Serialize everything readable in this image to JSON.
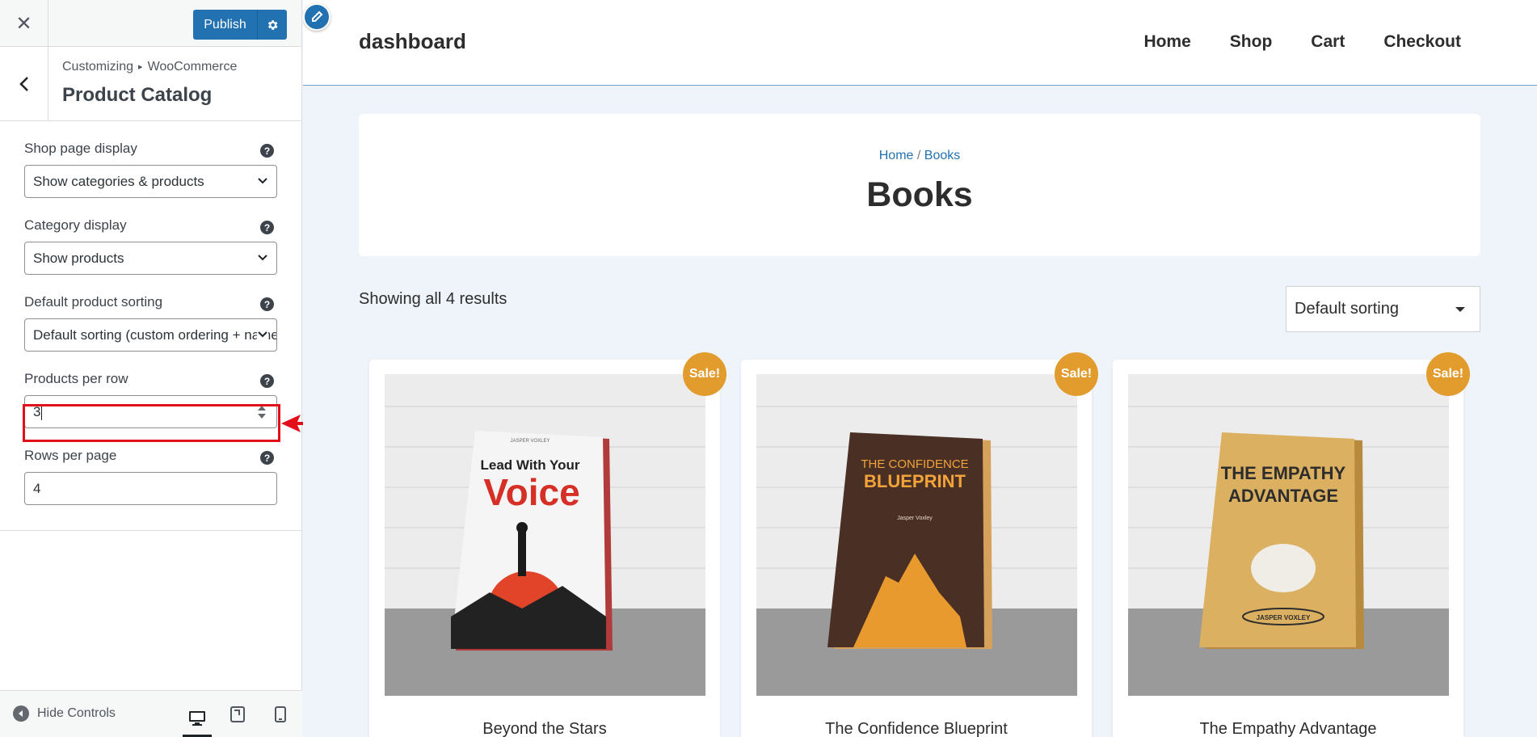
{
  "sidebar": {
    "close_glyph": "✕",
    "publish_label": "Publish",
    "breadcrumb": {
      "root": "Customizing",
      "separator": "▸",
      "current": "WooCommerce"
    },
    "section_title": "Product Catalog",
    "controls": [
      {
        "label": "Shop page display",
        "value": "Show categories & products",
        "help": "?"
      },
      {
        "label": "Category display",
        "value": "Show products",
        "help": "?"
      },
      {
        "label": "Default product sorting",
        "value": "Default sorting (custom ordering + name)",
        "help": "?"
      },
      {
        "label": "Products per row",
        "value": "3",
        "help": "?"
      },
      {
        "label": "Rows per page",
        "value": "4",
        "help": "?"
      }
    ],
    "footer": {
      "hide_controls_label": "Hide Controls"
    },
    "highlight_color": "#e3101c"
  },
  "preview": {
    "site_title": "dashboard",
    "nav": [
      "Home",
      "Shop",
      "Cart",
      "Checkout"
    ],
    "breadcrumb": {
      "home": "Home",
      "separator": " / ",
      "current": "Books"
    },
    "page_title": "Books",
    "result_count": "Showing all 4 results",
    "sorting": "Default sorting",
    "sale_badge": "Sale!",
    "products": [
      {
        "name": "Beyond the Stars",
        "cover_author": "JASPER VOXLEY",
        "cover_title_1": "Lead With Your",
        "cover_title_2": "Voice"
      },
      {
        "name": "The Confidence Blueprint",
        "cover_title_1": "THE CONFIDENCE",
        "cover_title_2": "BLUEPRINT",
        "cover_author": "Jasper Voxley"
      },
      {
        "name": "The Empathy Advantage",
        "cover_title_1": "THE EMPATHY",
        "cover_title_2": "ADVANTAGE",
        "cover_author": "JASPER VOXLEY"
      }
    ]
  },
  "colors": {
    "accent": "#2271b1",
    "sale": "#e29c2e",
    "preview_bg": "#eef4fa"
  }
}
